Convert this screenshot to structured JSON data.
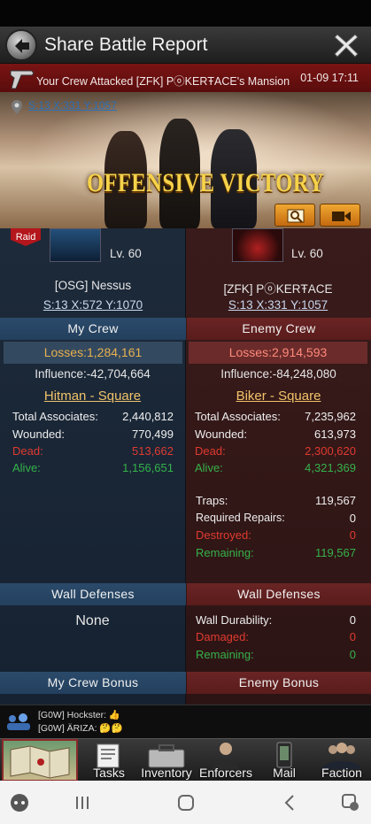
{
  "header": {
    "title": "Share Battle Report"
  },
  "attack": {
    "text": "Your Crew Attacked [ZFK] PⓞKERŦACE's Mansion",
    "time": "01-09 17:11",
    "location": "S:13 X:331 Y:1057"
  },
  "banner": {
    "result": "OFFENSIVE VICTORY"
  },
  "my_crew": {
    "badge": "Raid",
    "level": "Lv. 60",
    "name": "[OSG] Nessus",
    "coords": "S:13 X:572 Y:1070",
    "heading": "My Crew",
    "losses": "Losses:1,284,161",
    "influence": "Influence:-42,704,664",
    "tactic": "Hitman - Square",
    "stats": [
      {
        "label": "Total Associates:",
        "value": "2,440,812"
      },
      {
        "label": "Wounded:",
        "value": "770,499"
      },
      {
        "label": "Dead:",
        "value": "513,662"
      },
      {
        "label": "Alive:",
        "value": "1,156,651"
      }
    ],
    "wall_heading": "Wall Defenses",
    "wall_value": "None",
    "bonus_heading": "My Crew Bonus"
  },
  "enemy_crew": {
    "level": "Lv. 60",
    "name": "[ZFK] PⓞKERŦACE",
    "coords": "S:13 X:331 Y:1057",
    "heading": "Enemy Crew",
    "losses": "Losses:2,914,593",
    "influence": "Influence:-84,248,080",
    "tactic": "Biker - Square",
    "stats": [
      {
        "label": "Total Associates:",
        "value": "7,235,962"
      },
      {
        "label": "Wounded:",
        "value": "613,973"
      },
      {
        "label": "Dead:",
        "value": "2,300,620"
      },
      {
        "label": "Alive:",
        "value": "4,321,369"
      }
    ],
    "traps": [
      {
        "label": "Traps:",
        "value": "119,567"
      },
      {
        "label": "Required Repairs:",
        "value": "0"
      },
      {
        "label": "Destroyed:",
        "value": "0"
      },
      {
        "label": "Remaining:",
        "value": "119,567"
      }
    ],
    "wall_heading": "Wall Defenses",
    "wall": [
      {
        "label": "Wall Durability:",
        "value": "0"
      },
      {
        "label": "Damaged:",
        "value": "0"
      },
      {
        "label": "Remaining:",
        "value": "0"
      }
    ],
    "bonus_heading": "Enemy Bonus"
  },
  "chat": {
    "line1": "[G0W] Hockster: 👍",
    "line2": "[G0W] ÄRIZA: 🤔🤔"
  },
  "nav": {
    "tasks": "Tasks",
    "inventory": "Inventory",
    "enforcers": "Enforcers",
    "mail": "Mail",
    "faction": "Faction"
  },
  "colors": {
    "my_crew": "#23405e",
    "enemy_crew": "#5a1c1c",
    "dead": "#e03a30",
    "alive": "#34b24a",
    "tactic": "#f0c36a",
    "victory": "#f5d24a"
  }
}
